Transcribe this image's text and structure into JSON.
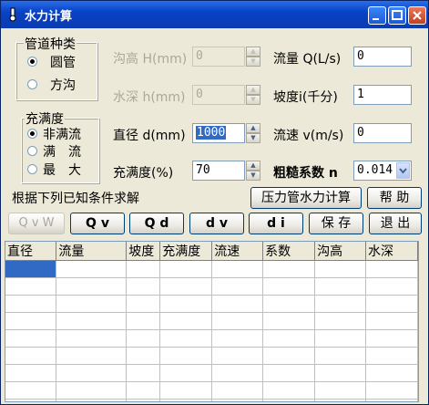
{
  "window": {
    "title": "水力计算"
  },
  "pipe_group": {
    "label": "管道种类",
    "options": [
      {
        "label": "圆管",
        "selected": true
      },
      {
        "label": "方沟",
        "selected": false
      }
    ]
  },
  "fill_group": {
    "label": "充满度",
    "options": [
      {
        "label": "非满流",
        "selected": true
      },
      {
        "label": "满　流",
        "selected": false
      },
      {
        "label": "最　大",
        "selected": false
      }
    ]
  },
  "fields": {
    "ditch_height": {
      "label": "沟高 H(mm)",
      "value": "0"
    },
    "water_depth": {
      "label": "水深 h(mm)",
      "value": "0"
    },
    "diameter": {
      "label": "直径 d(mm)",
      "value": "1000"
    },
    "fullness": {
      "label": "充满度(%)",
      "value": "70"
    },
    "flow": {
      "label": "流量 Q(L/s)",
      "value": "0"
    },
    "slope": {
      "label": "坡度i(千分)",
      "value": "1"
    },
    "velocity": {
      "label": "流速 v(m/s)",
      "value": "0"
    },
    "roughness": {
      "label": "粗糙系数 n",
      "value": "0.014"
    }
  },
  "hint": "根据下列已知条件求解",
  "buttons": {
    "pressure": "压力管水力计算",
    "help": "帮 助",
    "qvw": "Q v W",
    "qv": "Q v",
    "qd": "Q d",
    "dv": "d v",
    "di": "d i",
    "save": "保 存",
    "exit": "退 出"
  },
  "table": {
    "headers": [
      "直径",
      "流量",
      "坡度",
      "充满度",
      "流速",
      "系数",
      "沟高",
      "水深"
    ]
  }
}
